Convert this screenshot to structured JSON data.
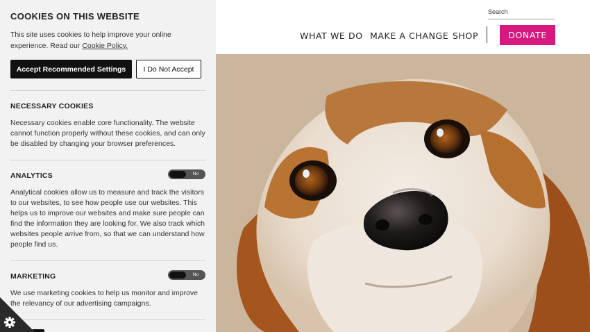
{
  "header": {
    "search_placeholder": "Search",
    "nav": [
      "WHAT WE DO",
      "MAKE A CHANGE",
      "SHOP"
    ],
    "donate_label": "DONATE",
    "accent_color": "#d6187f"
  },
  "hero": {
    "alt": "Close-up of a beagle's face"
  },
  "cookie_panel": {
    "title": "COOKIES ON THIS WEBSITE",
    "intro_text": "This site uses cookies to help improve your online experience. Read our ",
    "policy_link": "Cookie Policy.",
    "accept_label": "Accept Recommended Settings",
    "reject_label": "I Do Not Accept",
    "sections": [
      {
        "title": "NECESSARY COOKIES",
        "body": "Necessary cookies enable core functionality. The website cannot function properly without these cookies, and can only be disabled by changing your browser preferences."
      },
      {
        "title": "ANALYTICS",
        "toggle": "No",
        "body": "Analytical cookies allow us to measure and track the visitors to our websites, to see how people use our websites. This helps us to improve our websites and make sure people can find the information they are looking for. We also track which websites people arrive from, so that we can understand how people find us."
      },
      {
        "title": "MARKETING",
        "toggle": "No",
        "body": "We use marketing cookies to help us monitor and improve the relevancy of our advertising campaigns."
      }
    ],
    "settings_icon": "gear-icon"
  }
}
